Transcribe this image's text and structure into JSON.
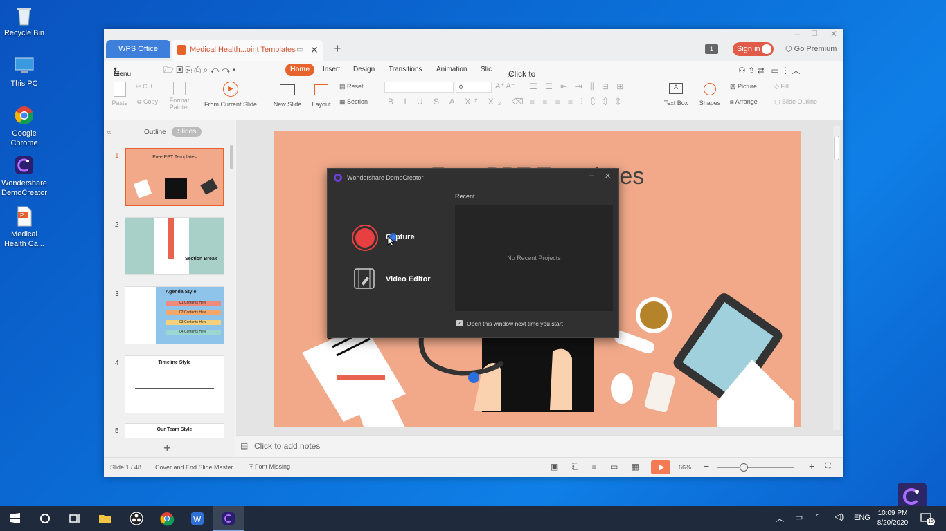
{
  "desktop": {
    "icons": [
      {
        "label": "Recycle Bin",
        "icon": "recycle-bin-icon"
      },
      {
        "label": "This PC",
        "icon": "computer-icon"
      },
      {
        "label": "Google Chrome",
        "icon": "chrome-icon"
      },
      {
        "label": "Wondershare DemoCreator",
        "icon": "democreator-icon"
      },
      {
        "label": "Medical Health Ca...",
        "icon": "pptx-file-icon"
      }
    ]
  },
  "window": {
    "tabs": {
      "wps": "WPS Office",
      "doc": "Medical Health...oint Templates"
    },
    "badge": "1",
    "sign_in": "Sign in",
    "go_premium": "Go Premium",
    "menu": {
      "menu_label": "Menu",
      "tabs": [
        "Home",
        "Insert",
        "Design",
        "Transitions",
        "Animation",
        "Slic"
      ],
      "active_tab": "Home",
      "search": "Click to find commands"
    },
    "ribbon": {
      "paste": "Paste",
      "cut": "Cut",
      "copy": "Copy",
      "format_painter": "Format Painter",
      "from_current_slide": "From Current Slide",
      "new_slide": "New Slide",
      "layout": "Layout",
      "reset": "Reset",
      "section": "Section",
      "font_size": "0",
      "text_box": "Text Box",
      "shapes": "Shapes",
      "picture": "Picture",
      "arrange": "Arrange",
      "fill": "Fill",
      "slide_outline": "Slide Outline"
    },
    "left_pane": {
      "tabs": [
        "Outline",
        "Slides"
      ],
      "active": "Slides",
      "thumbs": [
        {
          "num": "1",
          "title": "Free PPT Templates"
        },
        {
          "num": "2",
          "title": "Section Break"
        },
        {
          "num": "3",
          "title": "Agenda Style",
          "rows": [
            "01",
            "02",
            "03",
            "04"
          ],
          "row_text": "Contents Here"
        },
        {
          "num": "4",
          "title": "Timeline Style"
        },
        {
          "num": "5",
          "title": "Our Team Style"
        }
      ],
      "add": "+"
    },
    "slide_title": "Free PPT Templates",
    "notes_placeholder": "Click to add notes",
    "status": {
      "slide": "Slide 1 / 48",
      "master": "Cover and End Slide Master",
      "font_missing": "Font Missing",
      "zoom": "66%"
    }
  },
  "dialog": {
    "title": "Wondershare DemoCreator",
    "capture": "Capture",
    "video_editor": "Video Editor",
    "recent": "Recent",
    "no_recent": "No Recent Projects",
    "checkbox": "Open this window next time you start",
    "checked": true
  },
  "taskbar": {
    "lang": "ENG",
    "time": "10:09 PM",
    "date": "8/20/2020",
    "notif": "16"
  },
  "colors": {
    "accent": "#e8632b",
    "wps_blue": "#3f7fdc",
    "slide_bg": "#f1a98a",
    "record_red": "#e84040"
  }
}
